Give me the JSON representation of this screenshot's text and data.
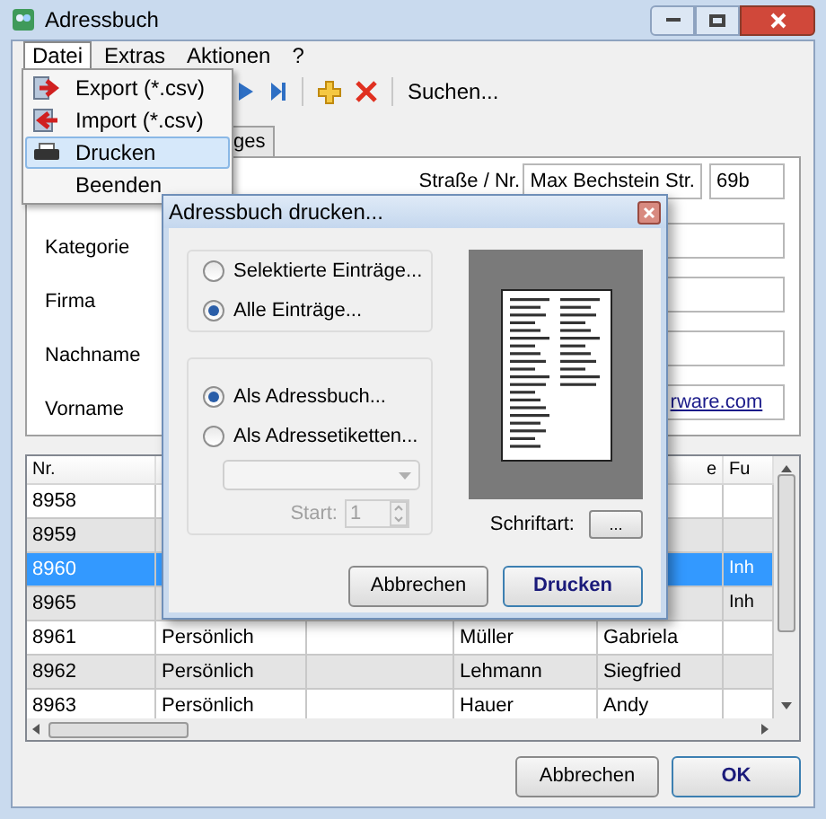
{
  "window": {
    "title": "Adressbuch"
  },
  "menu": [
    {
      "label": "Datei",
      "selected": true
    },
    {
      "label": "Extras",
      "selected": false
    },
    {
      "label": "Aktionen",
      "selected": false
    },
    {
      "label": "?",
      "selected": false
    }
  ],
  "file_menu": [
    {
      "label": "Export (*.csv)",
      "kind": "export",
      "selected": false
    },
    {
      "label": "Import (*.csv)",
      "kind": "import",
      "selected": false
    },
    {
      "label": "Drucken",
      "kind": "print",
      "selected": true
    },
    {
      "label": "Beenden",
      "kind": "plain",
      "selected": false
    }
  ],
  "toolbar": {
    "search": "Suchen..."
  },
  "tabs": [
    {
      "label": "ges",
      "selected": false
    }
  ],
  "form": {
    "labels": [
      "Kategorie",
      "Firma",
      "Nachname",
      "Vorname"
    ],
    "street_label": "Straße / Nr.",
    "street": "Max Bechstein Str.",
    "number": "69b",
    "web": "rware.com"
  },
  "table": {
    "columns": [
      {
        "label": "Nr."
      },
      {},
      {},
      {},
      {
        "label": "e"
      },
      {
        "label": "Fu"
      }
    ],
    "rows": [
      {
        "cells": [
          "8958",
          null,
          null,
          null,
          null,
          null
        ],
        "selected": false
      },
      {
        "cells": [
          "8959",
          null,
          null,
          null,
          null,
          null
        ],
        "selected": false
      },
      {
        "cells": [
          "8960",
          null,
          null,
          null,
          null,
          "Inh"
        ],
        "selected": true
      },
      {
        "cells": [
          "8965",
          null,
          null,
          null,
          null,
          "Inh"
        ],
        "selected": false
      },
      {
        "cells": [
          "8961",
          "Persönlich",
          null,
          "Müller",
          "Gabriela",
          null
        ],
        "selected": false
      },
      {
        "cells": [
          "8962",
          "Persönlich",
          null,
          "Lehmann",
          "Siegfried",
          null
        ],
        "selected": false
      },
      {
        "cells": [
          "8963",
          "Persönlich",
          null,
          "Hauer",
          "Andy",
          null
        ],
        "selected": false
      }
    ]
  },
  "buttons": [
    {
      "label": "Abbrechen",
      "default": false
    },
    {
      "label": "OK",
      "default": true
    }
  ],
  "dialog": {
    "title": "Adressbuch drucken...",
    "scope": [
      {
        "label": "Selektierte Einträge...",
        "selected": false
      },
      {
        "label": "Alle Einträge...",
        "selected": true
      }
    ],
    "format": [
      {
        "label": "Als Adressbuch...",
        "selected": true
      },
      {
        "label": "Als Adressetiketten...",
        "selected": false
      }
    ],
    "labels_disabled": true,
    "start_label": "Start:",
    "start_value": "1",
    "font_label": "Schriftart:",
    "font_button": "...",
    "buttons": [
      {
        "label": "Abbrechen",
        "default": false
      },
      {
        "label": "Drucken",
        "default": true
      }
    ]
  }
}
